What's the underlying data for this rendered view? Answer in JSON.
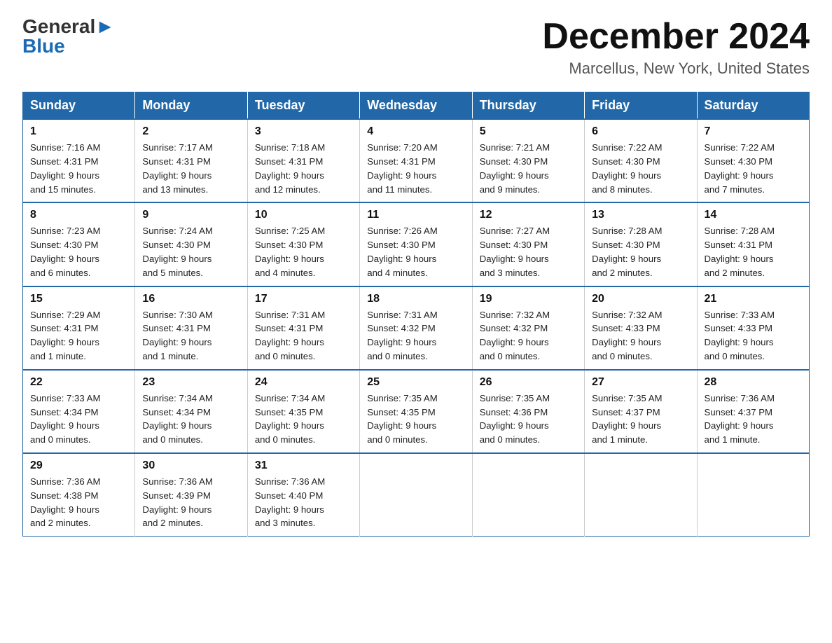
{
  "logo": {
    "top": "General",
    "bottom": "Blue"
  },
  "title": "December 2024",
  "location": "Marcellus, New York, United States",
  "days_header": [
    "Sunday",
    "Monday",
    "Tuesday",
    "Wednesday",
    "Thursday",
    "Friday",
    "Saturday"
  ],
  "weeks": [
    [
      {
        "num": "1",
        "info": "Sunrise: 7:16 AM\nSunset: 4:31 PM\nDaylight: 9 hours\nand 15 minutes."
      },
      {
        "num": "2",
        "info": "Sunrise: 7:17 AM\nSunset: 4:31 PM\nDaylight: 9 hours\nand 13 minutes."
      },
      {
        "num": "3",
        "info": "Sunrise: 7:18 AM\nSunset: 4:31 PM\nDaylight: 9 hours\nand 12 minutes."
      },
      {
        "num": "4",
        "info": "Sunrise: 7:20 AM\nSunset: 4:31 PM\nDaylight: 9 hours\nand 11 minutes."
      },
      {
        "num": "5",
        "info": "Sunrise: 7:21 AM\nSunset: 4:30 PM\nDaylight: 9 hours\nand 9 minutes."
      },
      {
        "num": "6",
        "info": "Sunrise: 7:22 AM\nSunset: 4:30 PM\nDaylight: 9 hours\nand 8 minutes."
      },
      {
        "num": "7",
        "info": "Sunrise: 7:22 AM\nSunset: 4:30 PM\nDaylight: 9 hours\nand 7 minutes."
      }
    ],
    [
      {
        "num": "8",
        "info": "Sunrise: 7:23 AM\nSunset: 4:30 PM\nDaylight: 9 hours\nand 6 minutes."
      },
      {
        "num": "9",
        "info": "Sunrise: 7:24 AM\nSunset: 4:30 PM\nDaylight: 9 hours\nand 5 minutes."
      },
      {
        "num": "10",
        "info": "Sunrise: 7:25 AM\nSunset: 4:30 PM\nDaylight: 9 hours\nand 4 minutes."
      },
      {
        "num": "11",
        "info": "Sunrise: 7:26 AM\nSunset: 4:30 PM\nDaylight: 9 hours\nand 4 minutes."
      },
      {
        "num": "12",
        "info": "Sunrise: 7:27 AM\nSunset: 4:30 PM\nDaylight: 9 hours\nand 3 minutes."
      },
      {
        "num": "13",
        "info": "Sunrise: 7:28 AM\nSunset: 4:30 PM\nDaylight: 9 hours\nand 2 minutes."
      },
      {
        "num": "14",
        "info": "Sunrise: 7:28 AM\nSunset: 4:31 PM\nDaylight: 9 hours\nand 2 minutes."
      }
    ],
    [
      {
        "num": "15",
        "info": "Sunrise: 7:29 AM\nSunset: 4:31 PM\nDaylight: 9 hours\nand 1 minute."
      },
      {
        "num": "16",
        "info": "Sunrise: 7:30 AM\nSunset: 4:31 PM\nDaylight: 9 hours\nand 1 minute."
      },
      {
        "num": "17",
        "info": "Sunrise: 7:31 AM\nSunset: 4:31 PM\nDaylight: 9 hours\nand 0 minutes."
      },
      {
        "num": "18",
        "info": "Sunrise: 7:31 AM\nSunset: 4:32 PM\nDaylight: 9 hours\nand 0 minutes."
      },
      {
        "num": "19",
        "info": "Sunrise: 7:32 AM\nSunset: 4:32 PM\nDaylight: 9 hours\nand 0 minutes."
      },
      {
        "num": "20",
        "info": "Sunrise: 7:32 AM\nSunset: 4:33 PM\nDaylight: 9 hours\nand 0 minutes."
      },
      {
        "num": "21",
        "info": "Sunrise: 7:33 AM\nSunset: 4:33 PM\nDaylight: 9 hours\nand 0 minutes."
      }
    ],
    [
      {
        "num": "22",
        "info": "Sunrise: 7:33 AM\nSunset: 4:34 PM\nDaylight: 9 hours\nand 0 minutes."
      },
      {
        "num": "23",
        "info": "Sunrise: 7:34 AM\nSunset: 4:34 PM\nDaylight: 9 hours\nand 0 minutes."
      },
      {
        "num": "24",
        "info": "Sunrise: 7:34 AM\nSunset: 4:35 PM\nDaylight: 9 hours\nand 0 minutes."
      },
      {
        "num": "25",
        "info": "Sunrise: 7:35 AM\nSunset: 4:35 PM\nDaylight: 9 hours\nand 0 minutes."
      },
      {
        "num": "26",
        "info": "Sunrise: 7:35 AM\nSunset: 4:36 PM\nDaylight: 9 hours\nand 0 minutes."
      },
      {
        "num": "27",
        "info": "Sunrise: 7:35 AM\nSunset: 4:37 PM\nDaylight: 9 hours\nand 1 minute."
      },
      {
        "num": "28",
        "info": "Sunrise: 7:36 AM\nSunset: 4:37 PM\nDaylight: 9 hours\nand 1 minute."
      }
    ],
    [
      {
        "num": "29",
        "info": "Sunrise: 7:36 AM\nSunset: 4:38 PM\nDaylight: 9 hours\nand 2 minutes."
      },
      {
        "num": "30",
        "info": "Sunrise: 7:36 AM\nSunset: 4:39 PM\nDaylight: 9 hours\nand 2 minutes."
      },
      {
        "num": "31",
        "info": "Sunrise: 7:36 AM\nSunset: 4:40 PM\nDaylight: 9 hours\nand 3 minutes."
      },
      null,
      null,
      null,
      null
    ]
  ]
}
